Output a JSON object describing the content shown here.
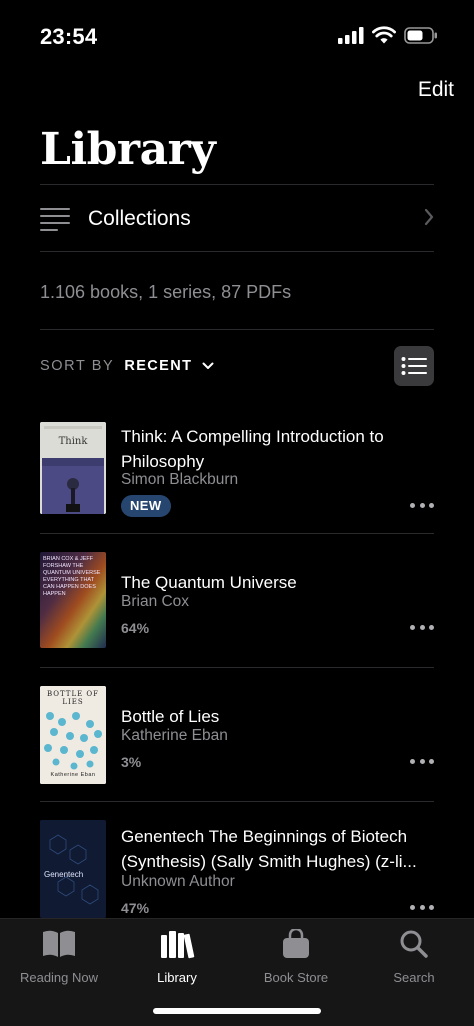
{
  "status": {
    "time": "23:54"
  },
  "header": {
    "edit_label": "Edit",
    "title": "Library"
  },
  "collections": {
    "label": "Collections"
  },
  "summary": {
    "counts": "1.106 books, 1 series, 87 PDFs"
  },
  "sort": {
    "by_label": "SORT BY",
    "value": "RECENT"
  },
  "books": [
    {
      "title": "Think: A Compelling Introduction to Philosophy",
      "author": "Simon Blackburn",
      "badge": "NEW",
      "progress": "",
      "cover_text": "Think",
      "cover_color": "#d9d9d4"
    },
    {
      "title": "The Quantum Universe",
      "author": "Brian Cox",
      "badge": "",
      "progress": "64%",
      "cover_text": "BRIAN COX & JEFF FORSHAW THE QUANTUM UNIVERSE EVERYTHING THAT CAN HAPPEN DOES HAPPEN",
      "cover_color": "#3a2a4a"
    },
    {
      "title": "Bottle of Lies",
      "author": "Katherine Eban",
      "badge": "",
      "progress": "3%",
      "cover_text": "BOTTLE OF LIES",
      "cover_color": "#efeae2"
    },
    {
      "title": "Genentech The Beginnings of Biotech (Synthesis) (Sally Smith Hughes) (z-li...",
      "author": "Unknown Author",
      "badge": "",
      "progress": "47%",
      "cover_text": "Genentech",
      "cover_color": "#101a33"
    }
  ],
  "tabs": [
    {
      "label": "Reading Now",
      "icon": "book-open-icon",
      "active": false
    },
    {
      "label": "Library",
      "icon": "books-stack-icon",
      "active": true
    },
    {
      "label": "Book Store",
      "icon": "shopping-bag-icon",
      "active": false
    },
    {
      "label": "Search",
      "icon": "magnifier-icon",
      "active": false
    }
  ],
  "colors": {
    "background": "#000000",
    "secondary_text": "#8e8e93",
    "badge_bg": "#27466f",
    "tab_bar_bg": "#161616"
  }
}
